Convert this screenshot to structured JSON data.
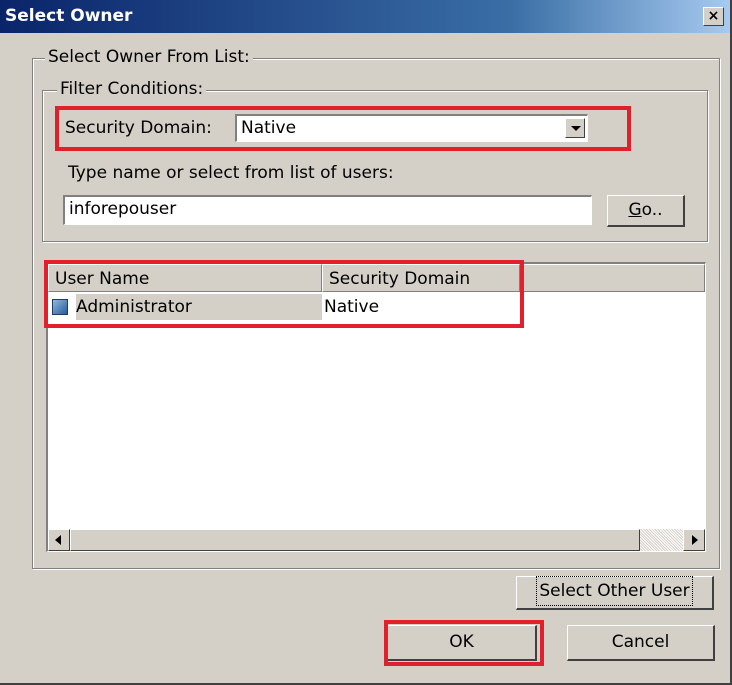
{
  "window": {
    "title": "Select Owner",
    "close_glyph": "×"
  },
  "owner_group": {
    "caption": "Select Owner From List:"
  },
  "filter_group": {
    "caption": "Filter Conditions:",
    "security_domain_label": "Security Domain:",
    "security_domain_value": "Native",
    "type_name_label": "Type name or select from list of users:",
    "user_input_value": "inforepouser",
    "go_label_underlined": "G",
    "go_label_rest": "o.."
  },
  "user_list": {
    "columns": [
      "User Name",
      "Security Domain"
    ],
    "rows": [
      {
        "icon": "user-icon",
        "user_name": "Administrator",
        "security_domain": "Native"
      }
    ]
  },
  "buttons": {
    "select_other_user": "Select Other User",
    "ok": "OK",
    "cancel": "Cancel"
  },
  "highlight_color": "#e0202a"
}
